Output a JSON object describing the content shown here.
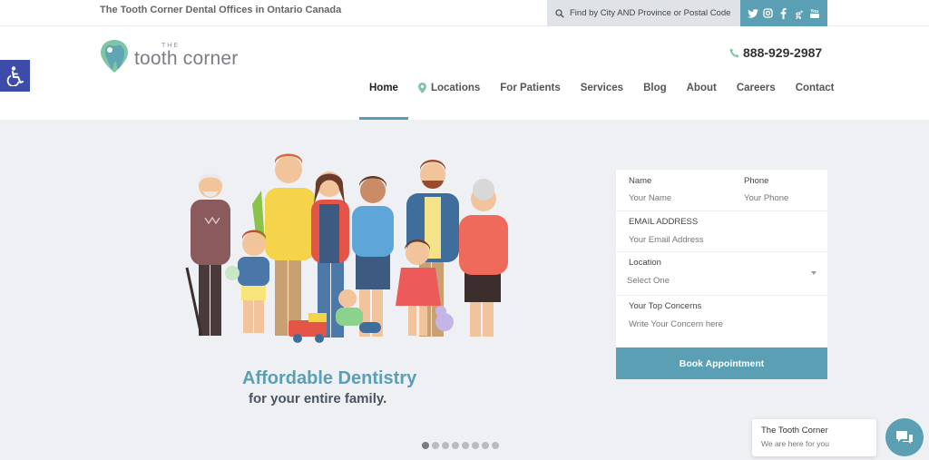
{
  "topbar": {
    "tagline": "The Tooth Corner Dental Offices in Ontario Canada",
    "finder": "Find by City AND Province or Postal Code",
    "social": [
      "twitter-icon",
      "instagram-icon",
      "facebook-icon",
      "google-plus-icon",
      "youtube-icon"
    ]
  },
  "logo": {
    "the": "THE",
    "name": "tooth corner"
  },
  "phone": "888-929-2987",
  "nav": {
    "home": "Home",
    "locations": "Locations",
    "patients": "For Patients",
    "services": "Services",
    "blog": "Blog",
    "about": "About",
    "careers": "Careers",
    "contact": "Contact"
  },
  "hero": {
    "title": "Affordable Dentistry",
    "subtitle": "for your entire family."
  },
  "form": {
    "name_label": "Name",
    "name_placeholder": "Your Name",
    "phone_label": "Phone",
    "phone_placeholder": "Your Phone",
    "email_label": "EMAIL ADDRESS",
    "email_placeholder": "Your Email Address",
    "location_label": "Location",
    "location_value": "Select One",
    "concern_label": "Your Top Concerns",
    "concern_placeholder": "Write Your Concern here",
    "submit": "Book Appointment"
  },
  "carousel": {
    "count": 8,
    "active": 1
  },
  "chat": {
    "title": "The Tooth Corner",
    "subtitle": "We are here for you"
  },
  "colors": {
    "accent": "#5b9fb5",
    "a11y": "#3c4ca8",
    "background": "#eef0f3"
  }
}
